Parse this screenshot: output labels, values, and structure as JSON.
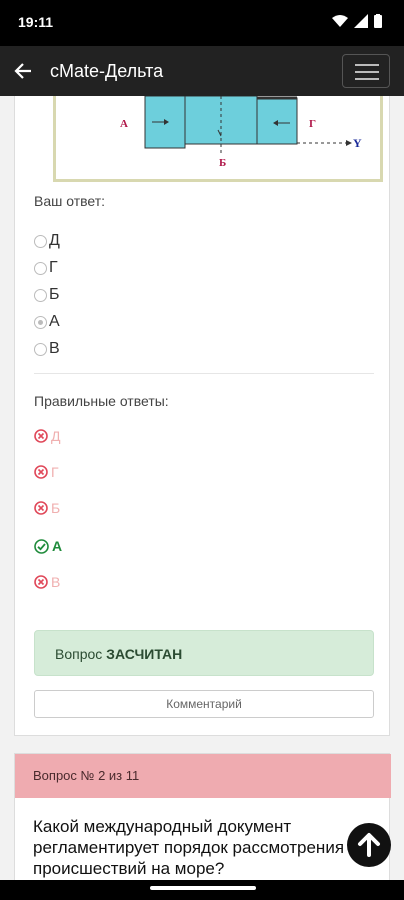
{
  "status_bar": {
    "time": "19:11"
  },
  "app_bar": {
    "title": "cMate-Дельта"
  },
  "figure": {
    "labels": {
      "a": "А",
      "b": "Б",
      "g": "Г",
      "y": "Y"
    }
  },
  "your_answer": {
    "label": "Ваш ответ:",
    "options": [
      {
        "text": "Д",
        "checked": false
      },
      {
        "text": "Г",
        "checked": false
      },
      {
        "text": "Б",
        "checked": false
      },
      {
        "text": "А",
        "checked": true
      },
      {
        "text": "В",
        "checked": false
      }
    ]
  },
  "correct_answers": {
    "label": "Правильные ответы:",
    "items": [
      {
        "text": "Д",
        "correct": false
      },
      {
        "text": "Г",
        "correct": false
      },
      {
        "text": "Б",
        "correct": false
      },
      {
        "text": "А",
        "correct": true
      },
      {
        "text": "В",
        "correct": false
      }
    ]
  },
  "result": {
    "prefix": "Вопрос",
    "status": "ЗАСЧИТАН"
  },
  "comment_button": "Комментарий",
  "next_question": {
    "header": "Вопрос № 2 из 11",
    "text": "Какой международный документ регламентирует порядок рассмотрения происшествий на море?"
  },
  "colors": {
    "correct": "#1f8b3b",
    "wrong": "#e0495a",
    "result_bg": "#d6ecd9",
    "question_header_bg": "#efabb0"
  }
}
